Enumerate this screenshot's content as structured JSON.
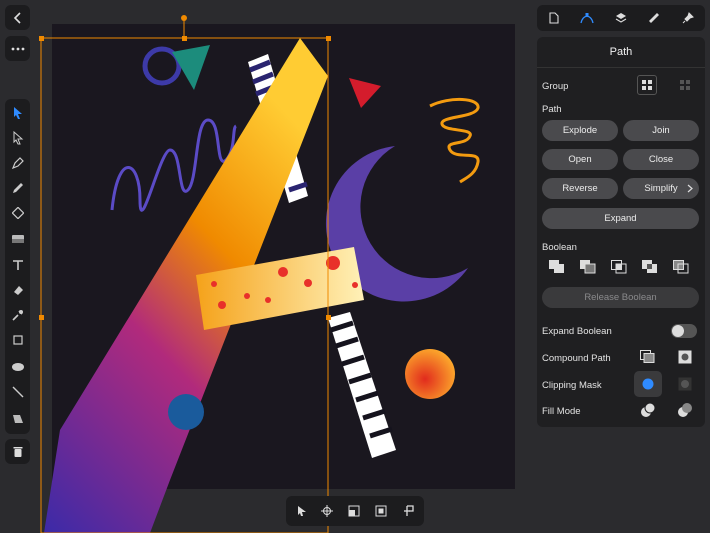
{
  "panel": {
    "title": "Path",
    "group_label": "Group",
    "path_label": "Path",
    "buttons": {
      "explode": "Explode",
      "join": "Join",
      "open": "Open",
      "close": "Close",
      "reverse": "Reverse",
      "simplify": "Simplify",
      "expand": "Expand",
      "release_boolean": "Release Boolean"
    },
    "boolean_label": "Boolean",
    "expand_boolean_label": "Expand Boolean",
    "compound_path_label": "Compound Path",
    "clipping_mask_label": "Clipping Mask",
    "fill_mode_label": "Fill Mode"
  },
  "icons": {
    "back": "chevron-left-icon",
    "more": "ellipsis-icon",
    "tabs": [
      "document-icon",
      "path-pen-icon",
      "layers-icon",
      "ruler-icon",
      "pin-icon"
    ],
    "tools": [
      "select-arrow-icon",
      "direct-select-icon",
      "pen-icon",
      "pencil-icon",
      "brush-icon",
      "gradient-icon",
      "text-icon",
      "eraser-icon",
      "eyedropper-icon",
      "crop-icon",
      "ellipse-icon",
      "line-icon",
      "shape-builder-icon"
    ],
    "trash": "trash-icon",
    "bottom": [
      "select-cursor-icon",
      "crosshair-icon",
      "transform-icon",
      "frame-icon",
      "pin-icon"
    ]
  },
  "colors": {
    "accent": "#2f8bff",
    "selection": "#f08a00",
    "canvas_bg": "#1a171f"
  }
}
